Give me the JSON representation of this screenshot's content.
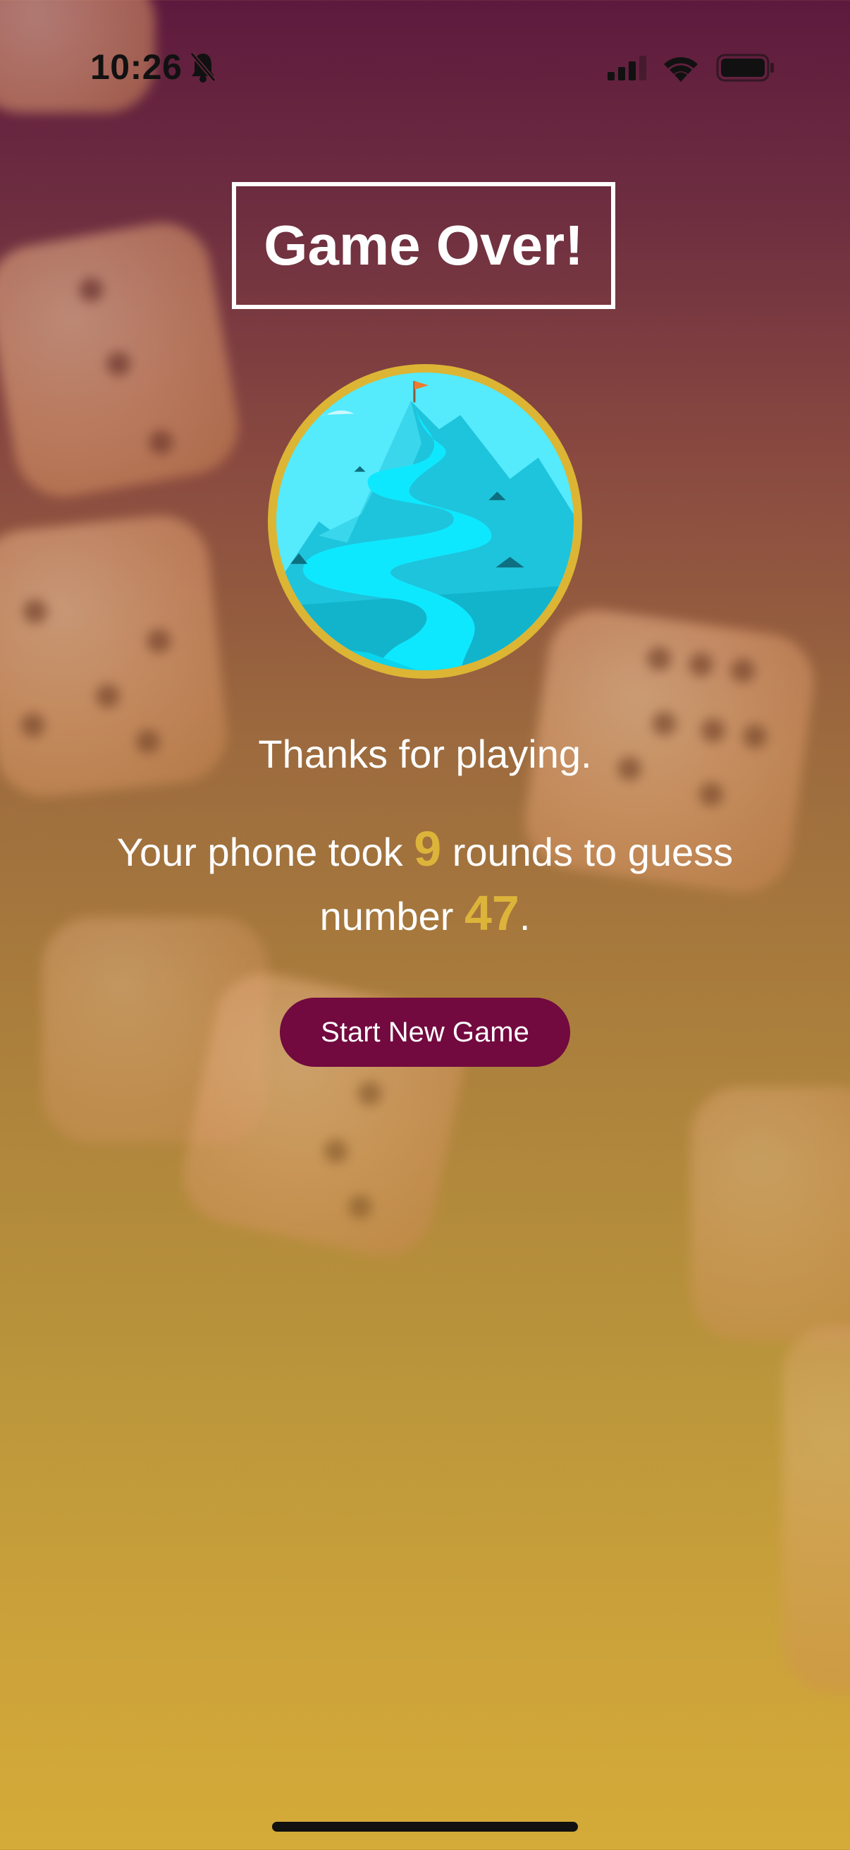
{
  "status_bar": {
    "time": "10:26",
    "icons": [
      "bell-slash-icon",
      "signal-icon",
      "wifi-icon",
      "battery-icon"
    ]
  },
  "screen": {
    "title": "Game Over!",
    "image": "mountain-summit-illustration",
    "thanks_text": "Thanks for playing.",
    "summary": {
      "prefix": "Your phone took",
      "rounds": "9",
      "middle": "rounds to guess number",
      "number": "47",
      "suffix": "."
    },
    "start_button_label": "Start New Game"
  },
  "colors": {
    "gradient_top": "#5e1a3e",
    "gradient_bottom": "#d4ab38",
    "highlight": "#ddb43a",
    "button": "#72093f",
    "badge_ring": "#dcb534"
  }
}
